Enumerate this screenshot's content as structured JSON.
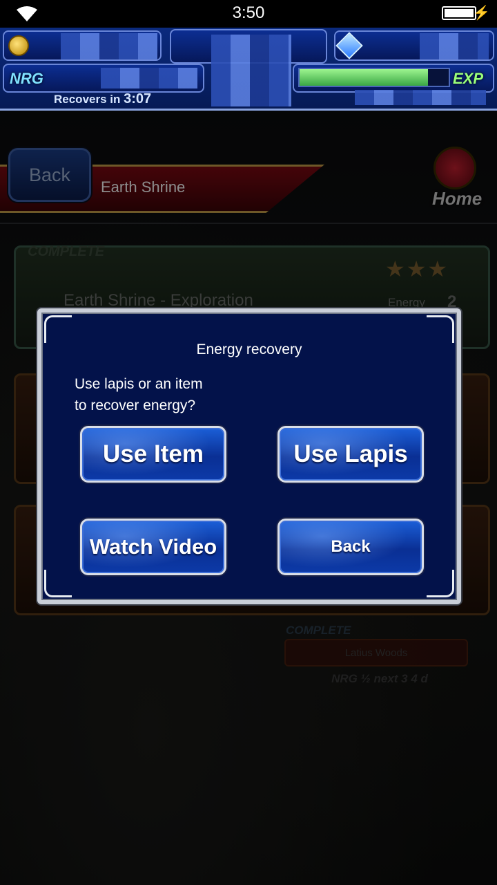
{
  "status_bar": {
    "time": "3:50"
  },
  "header": {
    "nrg_label": "NRG",
    "recovers_label": "Recovers  in",
    "recovers_time": "3:07",
    "exp_label": "EXP",
    "exp_fill_fraction": 0.86
  },
  "nav": {
    "back_label": "Back",
    "title": "Earth Shrine",
    "home_label": "Home"
  },
  "quests": {
    "first": {
      "status": "COMPLETE",
      "stars": "★★★",
      "name": "Earth Shrine - Exploration",
      "energy_label": "Energy",
      "energy_value": "2"
    },
    "latius": {
      "status": "COMPLETE",
      "name": "Latius Woods",
      "info": "NRG ½ next 3 4 d"
    }
  },
  "dialog": {
    "title": "Energy recovery",
    "message_line1": "Use lapis or an item",
    "message_line2": "to recover energy?",
    "use_item": "Use Item",
    "use_lapis": "Use Lapis",
    "watch_video": "Watch Video",
    "back": "Back"
  }
}
